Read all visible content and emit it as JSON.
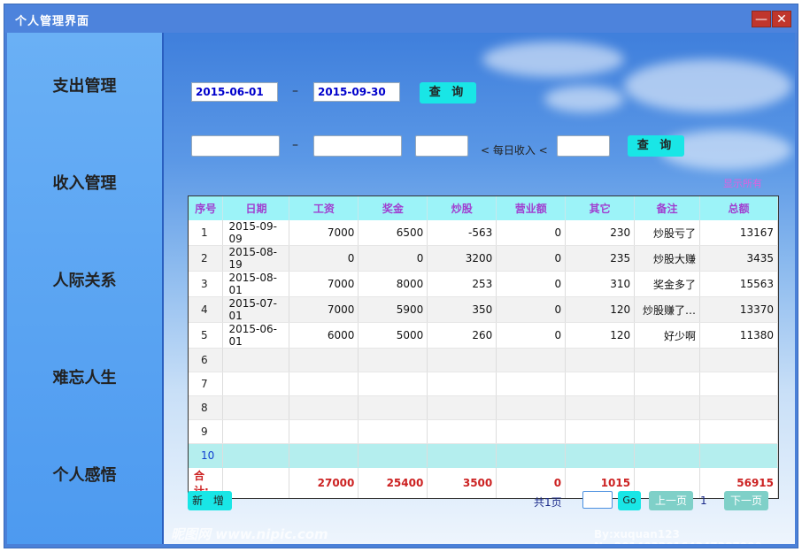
{
  "window": {
    "title": "个人管理界面",
    "minimize_label": "—",
    "close_label": "✕"
  },
  "sidebar": {
    "items": [
      {
        "label": "支出管理"
      },
      {
        "label": "收入管理"
      },
      {
        "label": "人际关系"
      },
      {
        "label": "难忘人生"
      },
      {
        "label": "个人感悟"
      }
    ]
  },
  "filters": {
    "start_date": "2015-06-01",
    "end_date": "2015-09-30",
    "dash": "–",
    "query_label": "查 询",
    "range_from": "",
    "range_to": "",
    "daily_min": "",
    "daily_income_label": "< 每日收入 <",
    "daily_max": "",
    "query2_label": "查 询"
  },
  "watermark_text": "显示所有",
  "table": {
    "headers": [
      "序号",
      "日期",
      "工资",
      "奖金",
      "炒股",
      "营业额",
      "其它",
      "备注",
      "总额"
    ],
    "rows": [
      [
        "1",
        "2015-09-09",
        "7000",
        "6500",
        "-563",
        "0",
        "230",
        "炒股亏了",
        "13167"
      ],
      [
        "2",
        "2015-08-19",
        "0",
        "0",
        "3200",
        "0",
        "235",
        "炒股大赚",
        "3435"
      ],
      [
        "3",
        "2015-08-01",
        "7000",
        "8000",
        "253",
        "0",
        "310",
        "奖金多了",
        "15563"
      ],
      [
        "4",
        "2015-07-01",
        "7000",
        "5900",
        "350",
        "0",
        "120",
        "炒股赚了…",
        "13370"
      ],
      [
        "5",
        "2015-06-01",
        "6000",
        "5000",
        "260",
        "0",
        "120",
        "好少啊",
        "11380"
      ],
      [
        "6",
        "",
        "",
        "",
        "",
        "",
        "",
        "",
        ""
      ],
      [
        "7",
        "",
        "",
        "",
        "",
        "",
        "",
        "",
        ""
      ],
      [
        "8",
        "",
        "",
        "",
        "",
        "",
        "",
        "",
        ""
      ],
      [
        "9",
        "",
        "",
        "",
        "",
        "",
        "",
        "",
        ""
      ],
      [
        "10",
        "",
        "",
        "",
        "",
        "",
        "",
        "",
        ""
      ]
    ],
    "selected_row": 10,
    "total": [
      "合计:",
      "",
      "27000",
      "25400",
      "3500",
      "0",
      "1015",
      "",
      "56915"
    ]
  },
  "pager": {
    "add_label": "新 增",
    "pages_label": "共1页",
    "page_input": "",
    "go_label": "Go",
    "prev_label": "上一页",
    "current_page": "1",
    "next_label": "下一页"
  },
  "footer": {
    "left": "昵图网 www.nipic.com",
    "right": "By:xuquan123 No.20140320164347387000"
  }
}
